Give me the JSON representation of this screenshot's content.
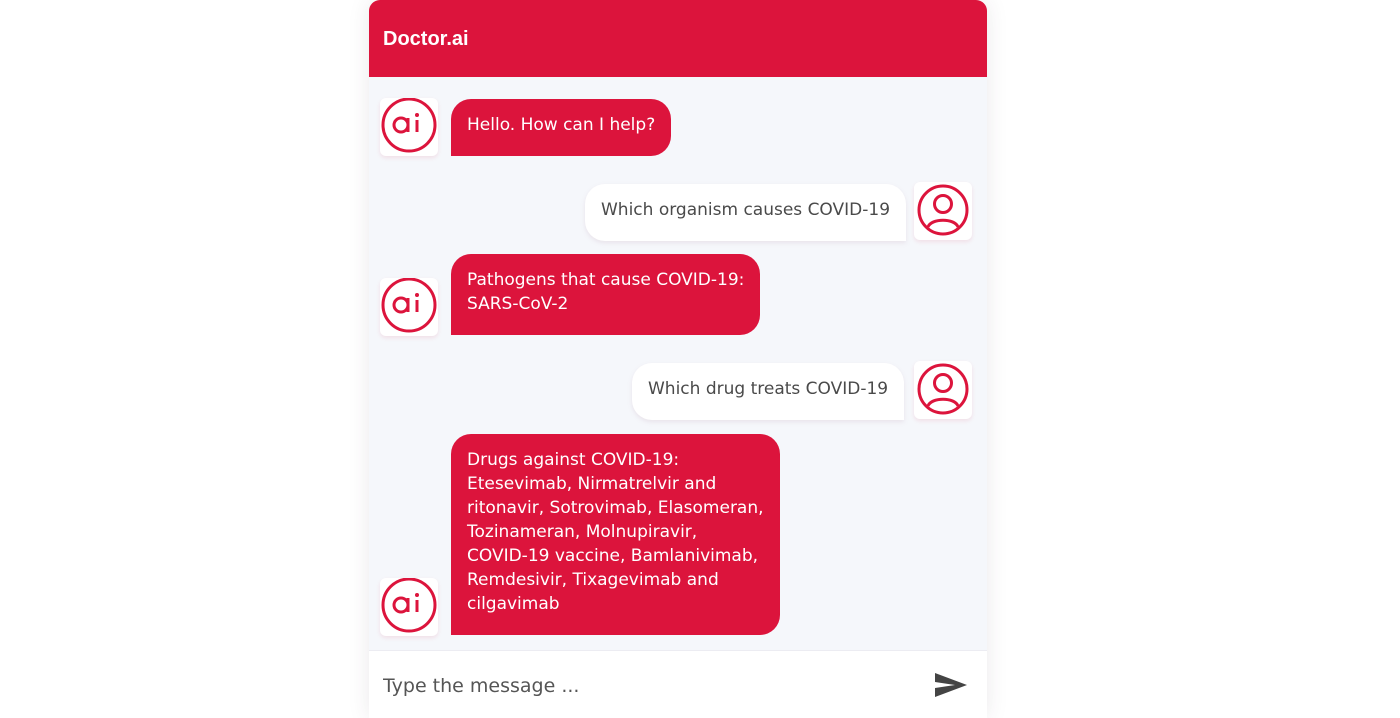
{
  "header": {
    "title": "Doctor.ai"
  },
  "messages": [
    {
      "sender": "bot",
      "text": "Hello. How can I help?"
    },
    {
      "sender": "user",
      "text": "Which organism causes COVID-19"
    },
    {
      "sender": "bot",
      "text": "Pathogens that cause COVID-19:\nSARS-CoV-2"
    },
    {
      "sender": "user",
      "text": "Which drug treats COVID-19"
    },
    {
      "sender": "bot",
      "text": "Drugs against COVID-19:\nEtesevimab, Nirmatrelvir and\nritonavir, Sotrovimab, Elasomeran,\nTozinameran, Molnupiravir,\nCOVID-19 vaccine, Bamlanivimab,\nRemdesivir, Tixagevimab and\ncilgavimab"
    }
  ],
  "composer": {
    "placeholder": "Type the message ..."
  },
  "icons": {
    "bot_avatar": "ai-logo-icon",
    "user_avatar": "user-icon",
    "send": "send-icon"
  },
  "colors": {
    "accent": "#dc143c",
    "background": "#f5f7fb",
    "user_bubble": "#ffffff"
  }
}
